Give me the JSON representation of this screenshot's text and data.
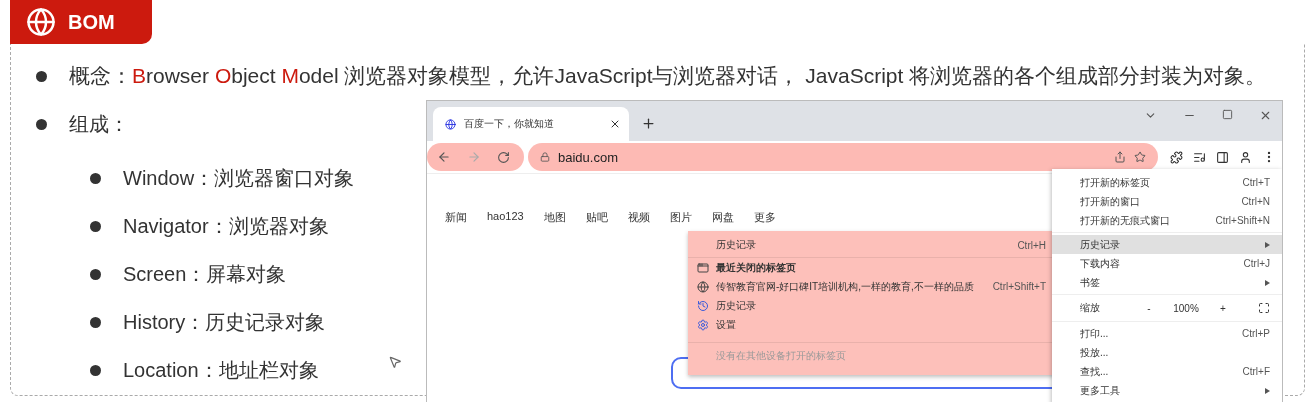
{
  "header": {
    "title": "BOM"
  },
  "concept": {
    "segments": [
      {
        "text": "概念：",
        "accent": false
      },
      {
        "text": "B",
        "accent": true
      },
      {
        "text": "rowser ",
        "accent": false
      },
      {
        "text": "O",
        "accent": true
      },
      {
        "text": "bject ",
        "accent": false
      },
      {
        "text": "M",
        "accent": true
      },
      {
        "text": "odel  浏览器对象模型，允许JavaScript与浏览器对话， JavaScript 将浏览器的各个组成部分封装为对象。",
        "accent": false
      }
    ]
  },
  "components": {
    "label": "组成：",
    "items": [
      "Window：浏览器窗口对象",
      "Navigator：浏览器对象",
      "Screen：屏幕对象",
      "History：历史记录对象",
      "Location：地址栏对象"
    ]
  },
  "browser": {
    "tab": {
      "title": "百度一下，你就知道"
    },
    "nav_highlighted": true,
    "address": {
      "url": "baidu.com",
      "highlighted": true
    },
    "links": [
      "新闻",
      "hao123",
      "地图",
      "贴吧",
      "视频",
      "图片",
      "网盘",
      "更多"
    ],
    "history_menu": {
      "highlighted": true,
      "items": [
        {
          "kind": "header",
          "label": "历史记录",
          "shortcut": "Ctrl+H"
        },
        {
          "kind": "tabs",
          "label": "最近关闭的标签页"
        },
        {
          "kind": "site",
          "label": "传智教育官网-好口碑IT培训机构,一样的教育,不一样的品质",
          "shortcut": "Ctrl+Shift+T"
        },
        {
          "kind": "history",
          "label": "历史记录"
        },
        {
          "kind": "settings",
          "label": "设置"
        },
        {
          "kind": "note",
          "label": "没有在其他设备打开的标签页"
        }
      ]
    },
    "main_menu": {
      "groups": [
        [
          {
            "kind": "item",
            "label": "打开新的标签页",
            "shortcut": "Ctrl+T",
            "selected": false
          },
          {
            "kind": "item",
            "label": "打开新的窗口",
            "shortcut": "Ctrl+N",
            "selected": false
          },
          {
            "kind": "item",
            "label": "打开新的无痕式窗口",
            "shortcut": "Ctrl+Shift+N",
            "selected": false
          }
        ],
        [
          {
            "kind": "submenu",
            "label": "历史记录",
            "selected": true
          },
          {
            "kind": "item",
            "label": "下载内容",
            "shortcut": "Ctrl+J",
            "selected": false
          },
          {
            "kind": "submenu",
            "label": "书签",
            "selected": false
          }
        ],
        [
          {
            "kind": "zoom",
            "label": "缩放",
            "minus": "-",
            "value": "100%",
            "plus": "+",
            "selected": false
          }
        ],
        [
          {
            "kind": "item",
            "label": "打印...",
            "shortcut": "Ctrl+P",
            "selected": false
          },
          {
            "kind": "item",
            "label": "投放...",
            "selected": false
          },
          {
            "kind": "item",
            "label": "查找...",
            "shortcut": "Ctrl+F",
            "selected": false
          },
          {
            "kind": "submenu",
            "label": "更多工具",
            "selected": false
          }
        ]
      ]
    }
  }
}
